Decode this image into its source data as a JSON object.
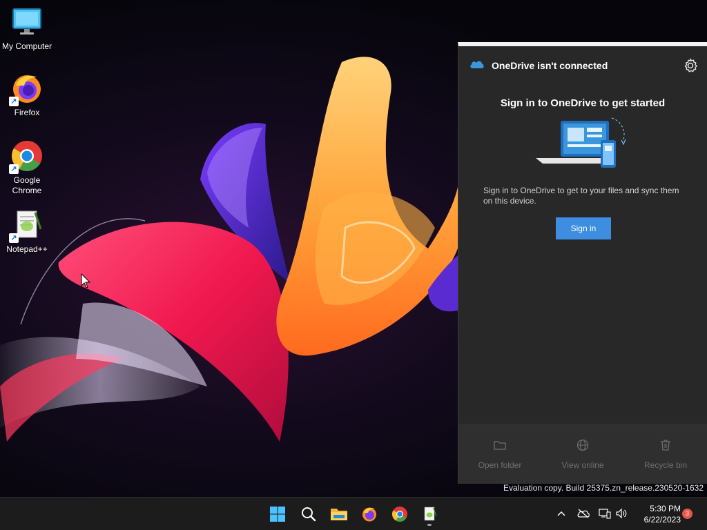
{
  "desktop": {
    "icons": [
      {
        "label": "My Computer",
        "icon": "monitor-icon"
      },
      {
        "label": "Firefox",
        "icon": "firefox-icon"
      },
      {
        "label": "Google\nChrome",
        "icon": "chrome-icon"
      },
      {
        "label": "Notepad++",
        "icon": "notepadpp-icon"
      }
    ]
  },
  "onedrive": {
    "title": "OneDrive isn't connected",
    "heading": "Sign in to OneDrive to get started",
    "description": "Sign in to OneDrive to get to your files and sync them on this device.",
    "signin_label": "Sign in",
    "footer": {
      "open_folder": "Open folder",
      "view_online": "View online",
      "recycle_bin": "Recycle bin"
    },
    "colors": {
      "accent": "#3d8ee0",
      "panel": "#282828"
    }
  },
  "watermark": "Evaluation copy. Build 25375.zn_release.230520-1632",
  "taskbar": {
    "apps": [
      "start-icon",
      "search-icon",
      "file-explorer-icon",
      "firefox-icon",
      "chrome-icon",
      "notepadpp-icon"
    ],
    "clock_time": "5:30 PM",
    "clock_date": "6/22/2023",
    "notification_count": "3"
  }
}
